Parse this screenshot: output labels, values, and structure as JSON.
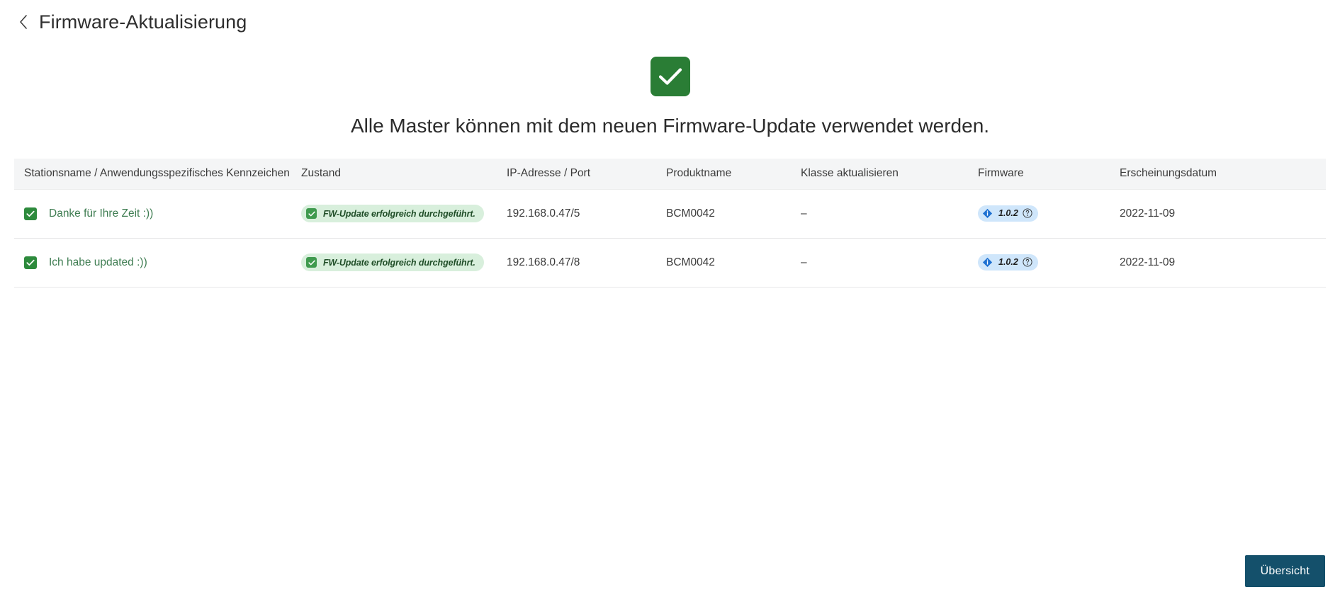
{
  "header": {
    "back_icon": "chevron-left-icon",
    "title": "Firmware-Aktualisierung"
  },
  "result": {
    "status_icon": "check-icon",
    "status_color": "#2a7d35",
    "message": "Alle Master können mit dem neuen Firmware-Update verwendet werden."
  },
  "table": {
    "columns": [
      "Stationsname / Anwendungsspezifisches Kennzeichen",
      "Zustand",
      "IP-Adresse / Port",
      "Produktname",
      "Klasse aktualisieren",
      "Firmware",
      "Erscheinungsdatum"
    ],
    "rows": [
      {
        "selected": true,
        "station_name": "Danke für Ihre Zeit :))",
        "state": "FW-Update erfolgreich durchgeführt.",
        "ip_port": "192.168.0.47/5",
        "product_name": "BCM0042",
        "update_class": "–",
        "firmware": "1.0.2",
        "release_date": "2022-11-09"
      },
      {
        "selected": true,
        "station_name": "Ich habe updated :))",
        "state": "FW-Update erfolgreich durchgeführt.",
        "ip_port": "192.168.0.47/8",
        "product_name": "BCM0042",
        "update_class": "–",
        "firmware": "1.0.2",
        "release_date": "2022-11-09"
      }
    ]
  },
  "footer": {
    "overview_button": "Übersicht"
  },
  "colors": {
    "success_green": "#2a7d35",
    "badge_green_bg": "#d8efdc",
    "firmware_badge_bg": "#cfe6fb",
    "firmware_icon_blue": "#1e71d2",
    "primary_button": "#14506b",
    "header_row_bg": "#f4f5f6"
  }
}
